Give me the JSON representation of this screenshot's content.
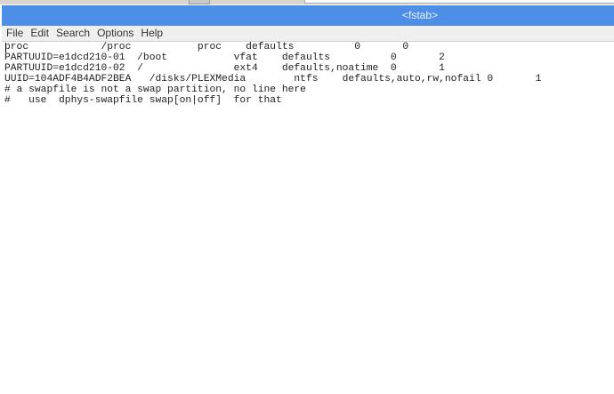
{
  "window": {
    "title": "<fstab>"
  },
  "menu": [
    "File",
    "Edit",
    "Search",
    "Options",
    "Help"
  ],
  "editor": {
    "lines": [
      "proc            /proc           proc    defaults          0       0",
      "PARTUUID=e1dcd210-01  /boot           vfat    defaults          0       2",
      "PARTUUID=e1dcd210-02  /               ext4    defaults,noatime  0       1",
      "UUID=104ADF4B4ADF2BEA   /disks/PLEXMedia        ntfs    defaults,auto,rw,nofail 0       1",
      "# a swapfile is not a swap partition, no line here",
      "#   use  dphys-swapfile swap[on|off]  for that"
    ]
  }
}
